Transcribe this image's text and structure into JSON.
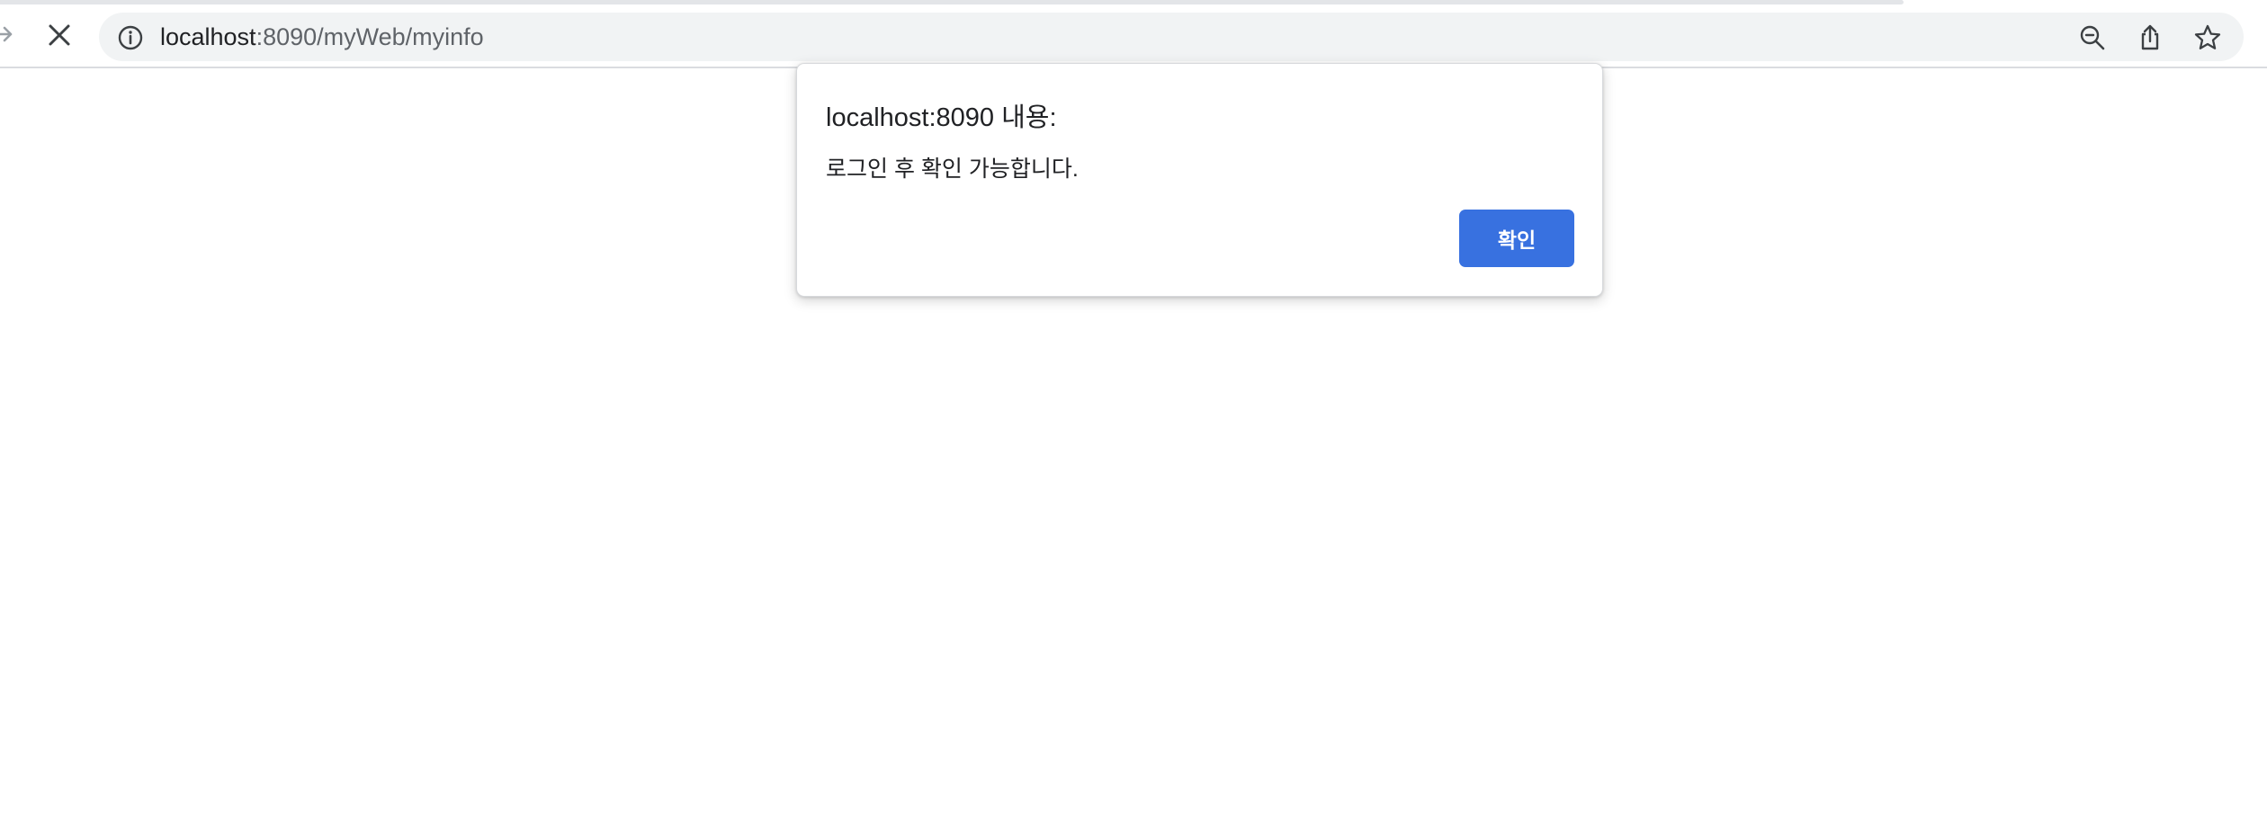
{
  "browser": {
    "url_host": "localhost",
    "url_rest": ":8090/myWeb/myinfo",
    "icons": {
      "forward": "forward-arrow-icon",
      "stop": "stop-loading-icon",
      "site_info": "info-icon",
      "zoom": "zoom-out-icon",
      "share": "share-icon",
      "bookmark": "star-icon"
    }
  },
  "dialog": {
    "title": "localhost:8090 내용:",
    "message": "로그인 후 확인 가능합니다.",
    "ok_label": "확인"
  },
  "colors": {
    "accent": "#3871e0",
    "omnibox_bg": "#f1f3f4",
    "text": "#202124"
  }
}
